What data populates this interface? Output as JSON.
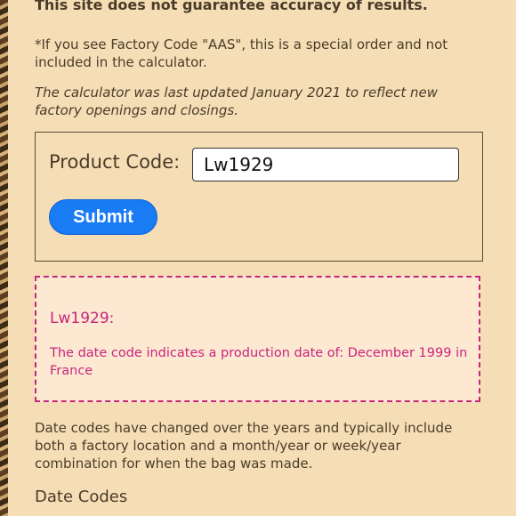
{
  "disclaimer": "This site does not guarantee accuracy of results.",
  "special_order_note": "*If you see Factory Code \"AAS\", this is a special order and not included in the calculator.",
  "update_note": "The calculator was last updated January 2021 to reflect new factory openings and closings.",
  "form": {
    "label": "Product Code:",
    "input_value": "Lw1929",
    "submit_label": "Submit"
  },
  "result": {
    "code": "Lw1929:",
    "message": "The date code indicates a production date of: December 1999 in France"
  },
  "info_text": "Date codes have changed over the years and typically include both a factory location and a month/year or week/year combination for when the bag was made.",
  "section_heading": "Date Codes",
  "colors": {
    "background": "#f5deb5",
    "accent_button": "#1a7cf5",
    "result_text": "#c7267c",
    "result_background": "#fde8d2"
  }
}
